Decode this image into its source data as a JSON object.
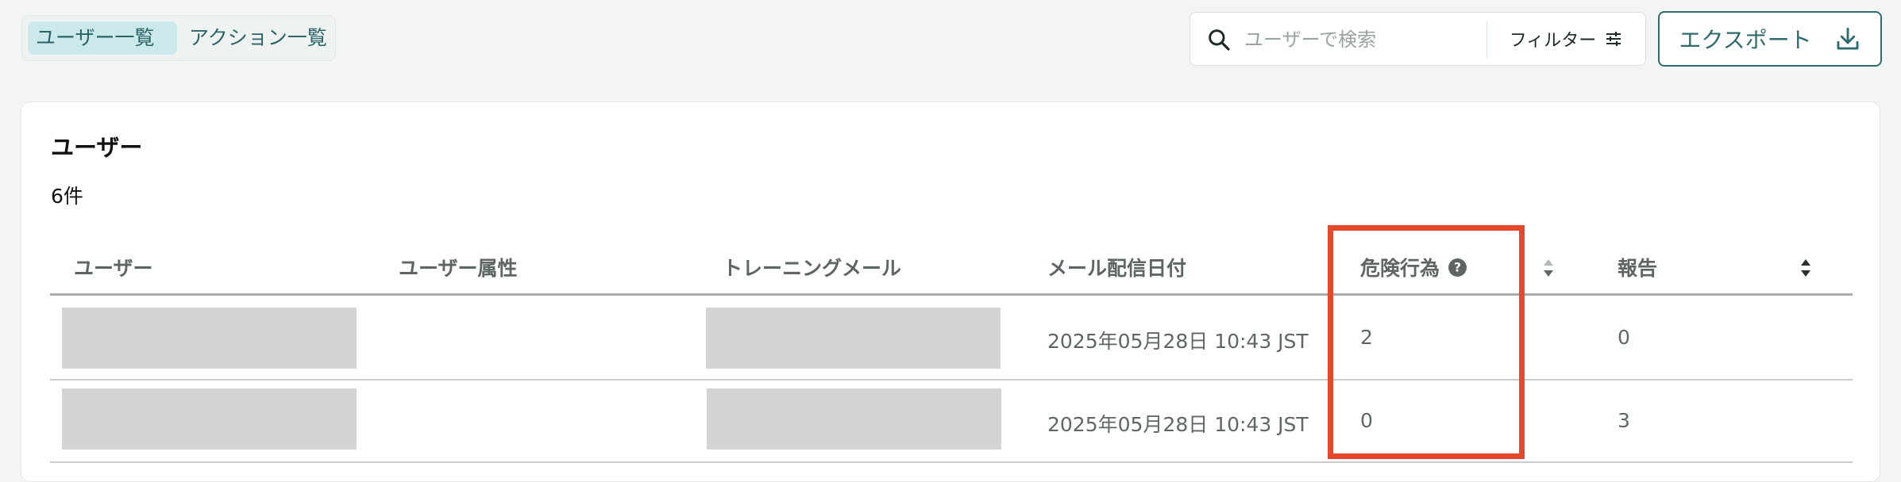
{
  "view_tabs": [
    {
      "label": "ユーザー一覧",
      "active": true
    },
    {
      "label": "アクション一覧",
      "active": false
    }
  ],
  "search": {
    "placeholder": "ユーザーで検索",
    "value": ""
  },
  "filter_label": "フィルター",
  "export_label": "エクスポート",
  "card": {
    "title": "ユーザー",
    "count": "6件"
  },
  "table": {
    "columns": [
      "ユーザー",
      "ユーザー属性",
      "トレーニングメール",
      "メール配信日付",
      "危険行為",
      "報告"
    ],
    "rows": [
      {
        "user": "",
        "attribute": "",
        "training_mail": "",
        "date": "2025年05月28日 10:43 JST",
        "risk": "2",
        "reports": "0"
      },
      {
        "user": "",
        "attribute": "",
        "training_mail": "",
        "date": "2025年05月28日 10:43 JST",
        "risk": "0",
        "reports": "3"
      }
    ]
  },
  "colors": {
    "accent": "#2f6a6e",
    "highlight": "#e5482a",
    "redaction": "#d4d4d4"
  },
  "icons": [
    "search-icon",
    "filter-sliders-icon",
    "download-icon",
    "help-circle-icon",
    "sort-icon"
  ]
}
